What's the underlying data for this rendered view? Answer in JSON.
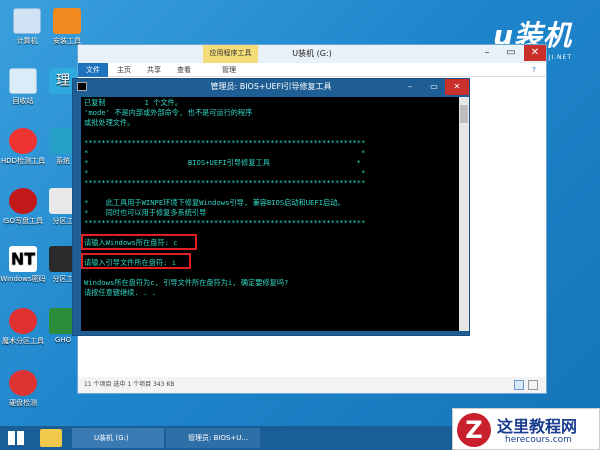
{
  "desktop": {
    "icons": [
      {
        "label": "计算机",
        "icon": "computer-icon"
      },
      {
        "label": "安装工具",
        "icon": "install-tool-icon"
      },
      {
        "label": "回收站",
        "icon": "recycle-bin-icon"
      },
      {
        "label": "理",
        "icon": "app-icon"
      },
      {
        "label": "HDD检测工具",
        "icon": "hdd-check-icon"
      },
      {
        "label": "系统",
        "icon": "system-icon"
      },
      {
        "label": "ISO写盘工具",
        "icon": "iso-write-icon"
      },
      {
        "label": "分区工",
        "icon": "partition-icon"
      },
      {
        "label": "Windows密码",
        "icon": "windows-password-icon"
      },
      {
        "label": "分区工",
        "icon": "partition-icon-2"
      },
      {
        "label": "魔术分区工具",
        "icon": "magic-partition-icon"
      },
      {
        "label": "GHO",
        "icon": "gho-icon"
      },
      {
        "label": "硬盘检测",
        "icon": "disk-detect-icon"
      }
    ]
  },
  "brand": {
    "main": "u装机",
    "sub": "UQIANJI.NET"
  },
  "explorer": {
    "title": "U装机 (G:)",
    "context_tab": "应用程序工具",
    "tabs": [
      "文件",
      "主页",
      "共享",
      "查看",
      "管理"
    ],
    "status": "11 个项目   选中 1 个项目  343 KB"
  },
  "cmd": {
    "title": "管理员:  BIOS+UEFI引导修复工具",
    "lines": [
      "已复制         1 个文件。",
      "'mode' 不是内部或外部命令, 也不是可运行的程序",
      "或批处理文件。",
      "",
      "*****************************************************************",
      "*                                                               *",
      "*                       BIOS+UEFI引导修复工具                    *",
      "*                                                               *",
      "*****************************************************************",
      "",
      "*    此工具用于WINPE环境下修复Windows引导, 兼容BIOS启动和UEFI启动。",
      "*    同时也可以用于修复多系统引导",
      "*****************************************************************",
      "",
      "请输入Windows所在盘符: c",
      "",
      "请输入引导文件所在盘符: i",
      "",
      "Windows所在盘符为c, 引导文件所在盘符为i, 确定要修复吗?",
      "请按任意键继续. . ."
    ]
  },
  "taskbar": {
    "items": [
      "U装机 (G:)",
      "管理员:  BIOS+U..."
    ]
  },
  "watermark": {
    "title": "这里教程网",
    "url": "herecours.com"
  }
}
